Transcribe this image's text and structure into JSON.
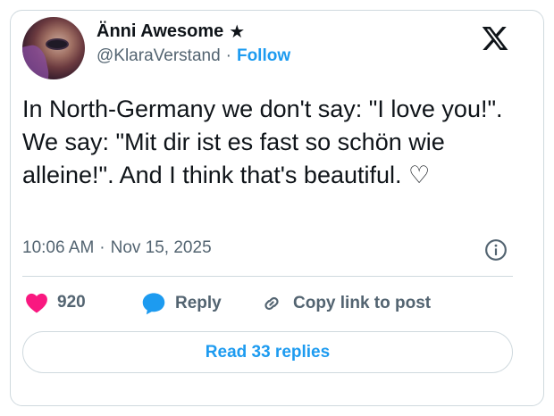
{
  "author": {
    "display_name": "Änni Awesome",
    "badge": "★",
    "handle": "@KlaraVerstand",
    "separator": "·",
    "follow_label": "Follow"
  },
  "tweet": {
    "text": "In North-Germany we don't say: \"I love you!\". We say: \"Mit dir ist es fast so schön wie alleine!\". And I think that's beautiful. ♡",
    "time": "10:06 AM",
    "separator": "·",
    "date": "Nov 15, 2025"
  },
  "actions": {
    "like_count": "920",
    "reply_label": "Reply",
    "copy_label": "Copy link to post"
  },
  "read_replies_label": "Read 33 replies",
  "icons": {
    "brand": "x-logo-icon",
    "info": "info-icon",
    "like": "heart-icon",
    "reply": "speech-bubble-icon",
    "copy": "link-icon"
  },
  "colors": {
    "accent": "#1d9bf0",
    "like": "#f91880",
    "text": "#0f1419",
    "muted": "#536471",
    "border": "#cfd9de"
  }
}
